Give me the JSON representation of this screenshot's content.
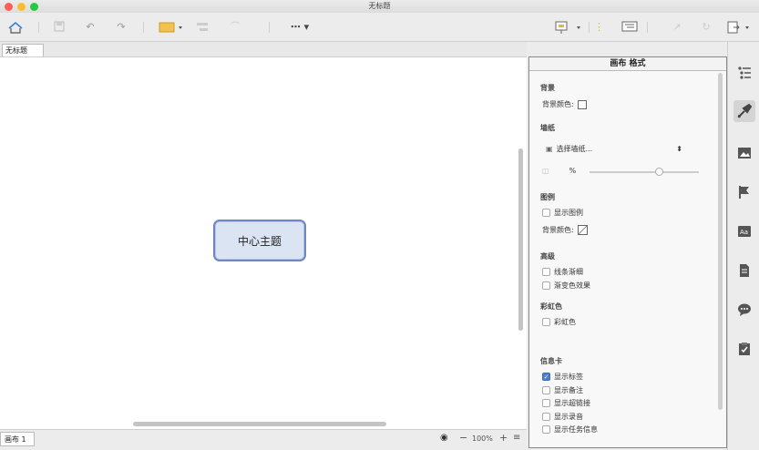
{
  "window": {
    "title": "无标题"
  },
  "tabs": [
    {
      "label": "无标题"
    }
  ],
  "canvas": {
    "central_topic": "中心主题"
  },
  "statusbar": {
    "sheet_label": "画布 1",
    "zoom": "100%"
  },
  "format_panel": {
    "title": "画布 格式",
    "background": {
      "heading": "背景",
      "color_label": "背景颜色:"
    },
    "wallpaper": {
      "heading": "墙纸",
      "select_label": "选择墙纸...",
      "percent_symbol": "%"
    },
    "legend": {
      "heading": "图例",
      "show_legend": "显示图例",
      "color_label": "背景颜色:"
    },
    "advanced": {
      "heading": "高级",
      "taper_lines": "线条渐细",
      "gradient_effect": "渐变色效果"
    },
    "rainbow": {
      "heading": "彩虹色",
      "rainbow_option": "彩虹色"
    },
    "info_card": {
      "heading": "信息卡",
      "items": [
        {
          "label": "显示标签",
          "checked": true
        },
        {
          "label": "显示备注",
          "checked": false
        },
        {
          "label": "显示超链接",
          "checked": false
        },
        {
          "label": "显示录音",
          "checked": false
        },
        {
          "label": "显示任务信息",
          "checked": false
        }
      ]
    }
  },
  "right_sidebar": {
    "icons": [
      "outline-icon",
      "format-brush-icon",
      "image-icon",
      "marker-flag-icon",
      "style-icon",
      "notes-icon",
      "comments-icon",
      "task-icon"
    ],
    "active": "format-brush-icon"
  },
  "colors": {
    "accent": "#4a7fd0",
    "topic_border": "#6e86c2",
    "topic_fill": "#dbe4f3"
  }
}
